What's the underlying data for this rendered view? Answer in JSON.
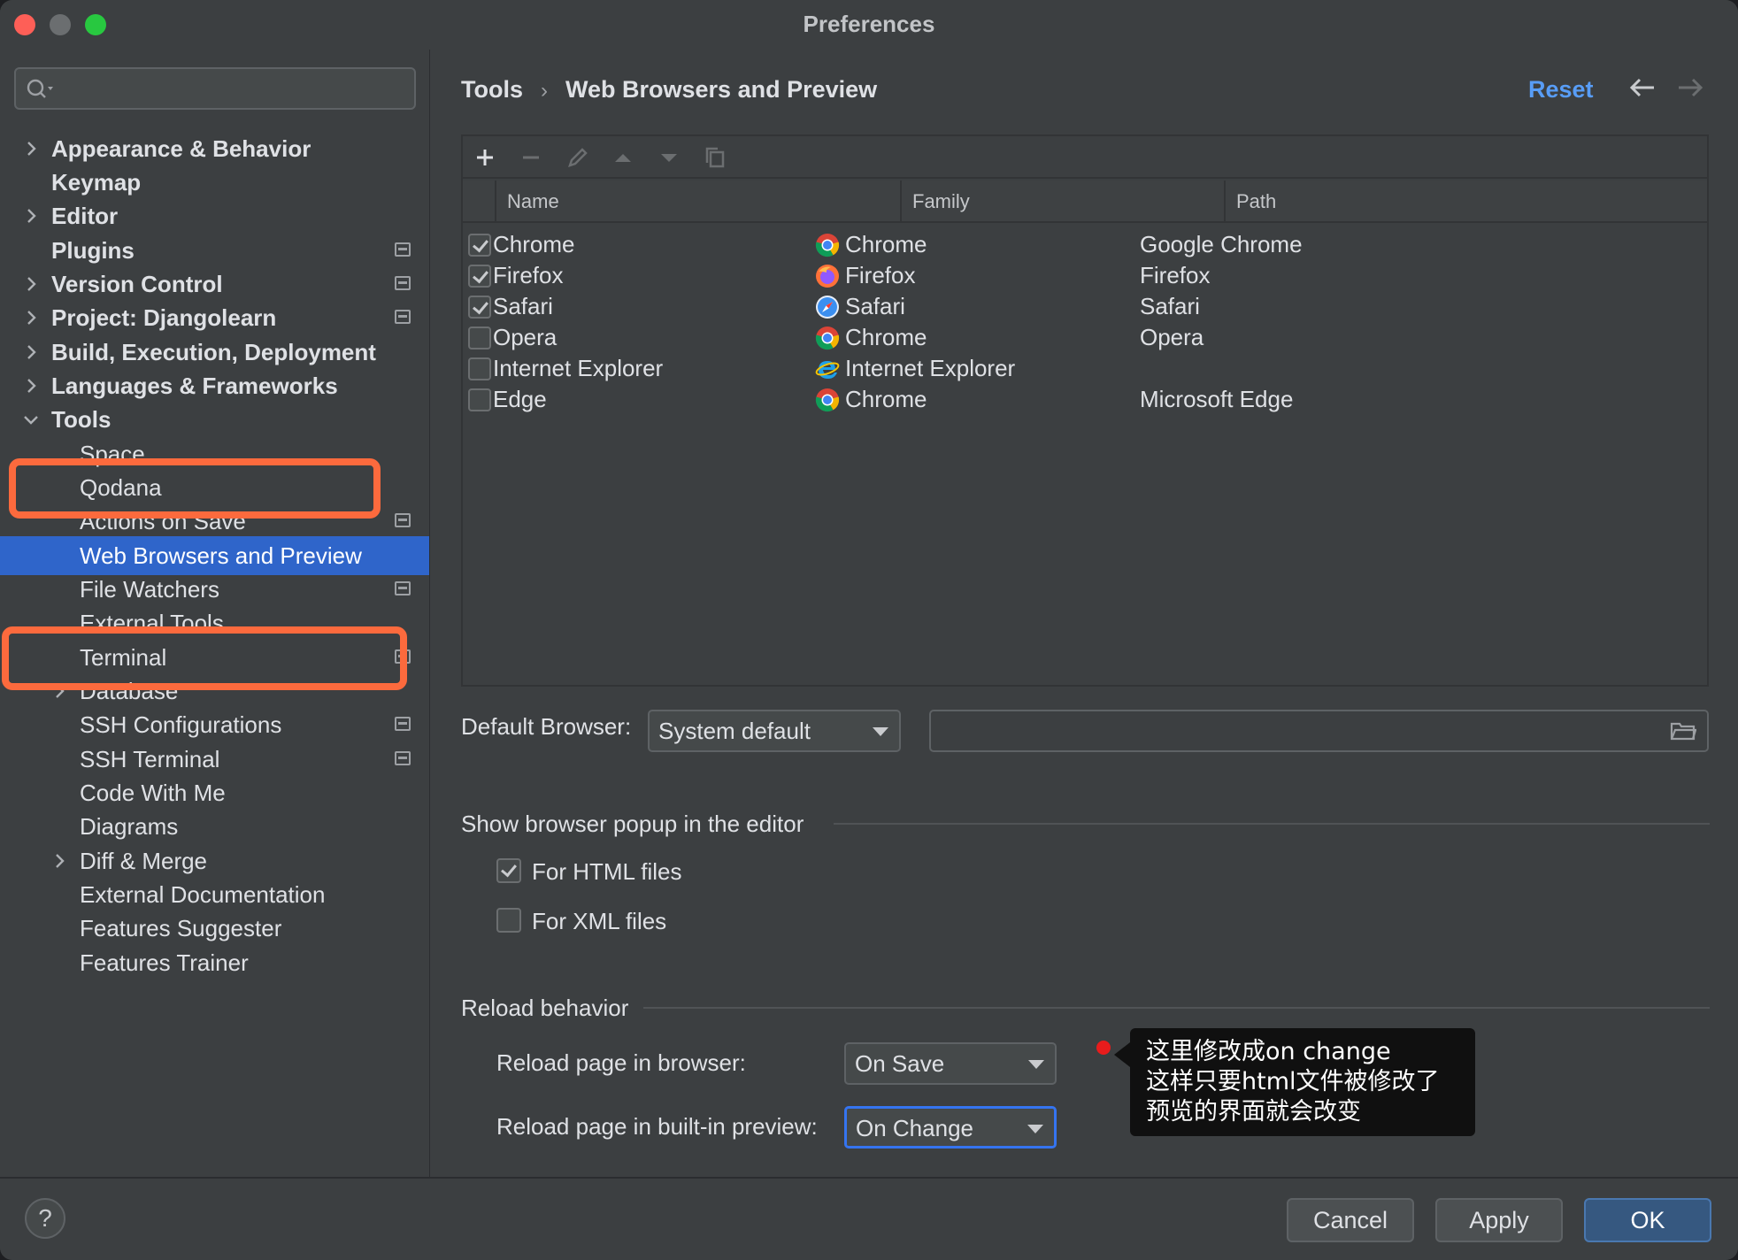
{
  "window": {
    "title": "Preferences"
  },
  "search": {
    "placeholder": ""
  },
  "sidebar": {
    "items": [
      {
        "label": "Appearance & Behavior"
      },
      {
        "label": "Keymap"
      },
      {
        "label": "Editor"
      },
      {
        "label": "Plugins"
      },
      {
        "label": "Version Control"
      },
      {
        "label": "Project: Djangolearn"
      },
      {
        "label": "Build, Execution, Deployment"
      },
      {
        "label": "Languages & Frameworks"
      },
      {
        "label": "Tools"
      },
      {
        "label": "Space"
      },
      {
        "label": "Qodana"
      },
      {
        "label": "Actions on Save"
      },
      {
        "label": "Web Browsers and Preview"
      },
      {
        "label": "File Watchers"
      },
      {
        "label": "External Tools"
      },
      {
        "label": "Terminal"
      },
      {
        "label": "Database"
      },
      {
        "label": "SSH Configurations"
      },
      {
        "label": "SSH Terminal"
      },
      {
        "label": "Code With Me"
      },
      {
        "label": "Diagrams"
      },
      {
        "label": "Diff & Merge"
      },
      {
        "label": "External Documentation"
      },
      {
        "label": "Features Suggester"
      },
      {
        "label": "Features Trainer"
      }
    ]
  },
  "header": {
    "breadcrumb_parent": "Tools",
    "breadcrumb_separator": "›",
    "breadcrumb_current": "Web Browsers and Preview",
    "reset_label": "Reset"
  },
  "browsers_table": {
    "columns": [
      "Name",
      "Family",
      "Path"
    ],
    "rows": [
      {
        "enabled": true,
        "name": "Chrome",
        "family": "Chrome",
        "family_icon": "chrome-icon",
        "path": "Google Chrome"
      },
      {
        "enabled": true,
        "name": "Firefox",
        "family": "Firefox",
        "family_icon": "firefox-icon",
        "path": "Firefox"
      },
      {
        "enabled": true,
        "name": "Safari",
        "family": "Safari",
        "family_icon": "safari-icon",
        "path": "Safari"
      },
      {
        "enabled": false,
        "name": "Opera",
        "family": "Chrome",
        "family_icon": "chrome-icon",
        "path": "Opera"
      },
      {
        "enabled": false,
        "name": "Internet Explorer",
        "family": "Internet Explorer",
        "family_icon": "ie-icon",
        "path": ""
      },
      {
        "enabled": false,
        "name": "Edge",
        "family": "Chrome",
        "family_icon": "chrome-icon",
        "path": "Microsoft Edge"
      }
    ]
  },
  "default_browser": {
    "label": "Default Browser:",
    "value": "System default",
    "path_value": ""
  },
  "popup_section": {
    "title": "Show browser popup in the editor",
    "for_html": {
      "label": "For HTML files",
      "checked": true
    },
    "for_xml": {
      "label": "For XML files",
      "checked": false
    }
  },
  "reload_section": {
    "title": "Reload behavior",
    "browser_label": "Reload page in browser:",
    "browser_value": "On Save",
    "preview_label": "Reload page in built-in preview:",
    "preview_value": "On Change"
  },
  "annotation": {
    "lines": [
      "这里修改成on change",
      "这样只要html文件被修改了",
      "预览的界面就会改变"
    ]
  },
  "footer": {
    "help_label": "?",
    "cancel_label": "Cancel",
    "apply_label": "Apply",
    "ok_label": "OK"
  },
  "colors": {
    "accent": "#2f65ca",
    "link": "#589df6",
    "highlight": "#fc6a3d",
    "background": "#3c3f41"
  }
}
